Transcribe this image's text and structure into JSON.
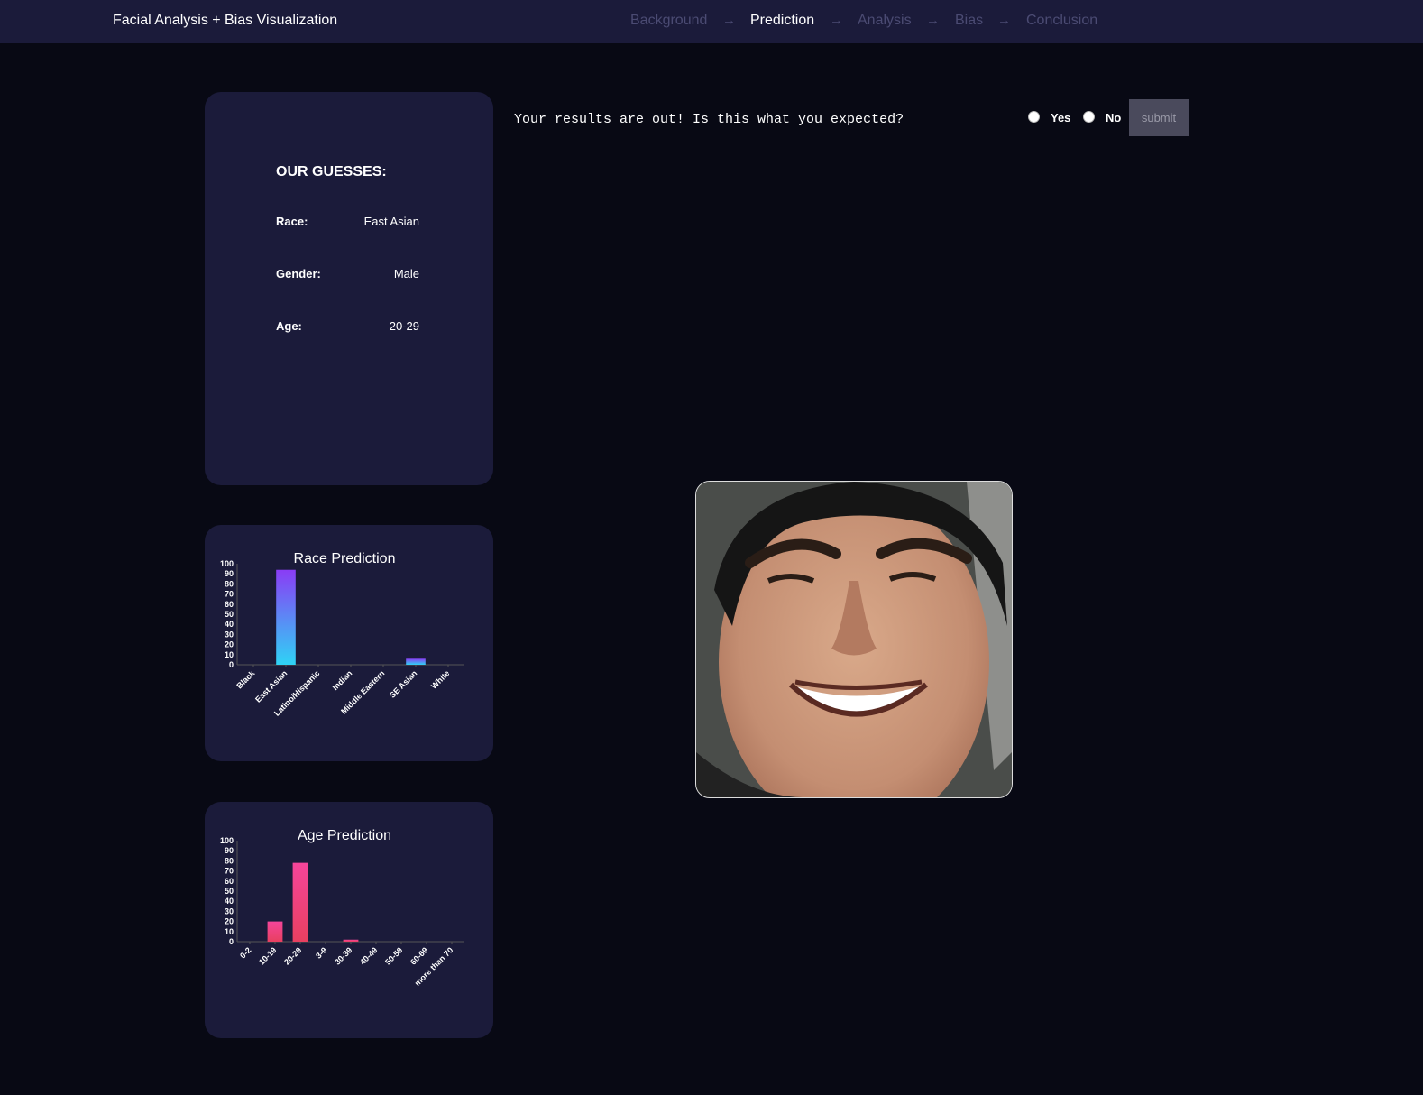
{
  "nav": {
    "title": "Facial Analysis + Bias Visualization",
    "steps": [
      "Background",
      "Prediction",
      "Analysis",
      "Bias",
      "Conclusion"
    ],
    "active_step": "Prediction",
    "arrow": "→"
  },
  "guesses": {
    "title": "OUR GUESSES:",
    "race_label": "Race:",
    "race_value": "East Asian",
    "gender_label": "Gender:",
    "gender_value": "Male",
    "age_label": "Age:",
    "age_value": "20-29"
  },
  "feedback": {
    "question": "Your results are out! Is this what you expected?",
    "yes_label": "Yes",
    "no_label": "No",
    "submit_label": "submit"
  },
  "photo": {
    "icon": "face-photo"
  },
  "colors": {
    "nav_bg": "#1b1b3a",
    "page_bg": "#080914",
    "race_bar_top": "#8a3cf5",
    "race_bar_bottom": "#2fd3f5",
    "age_bar_top": "#f5459a",
    "age_bar_bottom": "#e84060"
  },
  "chart_data": [
    {
      "type": "bar",
      "title": "Race Prediction",
      "categories": [
        "Black",
        "East Asian",
        "Latino/Hispanic",
        "Indian",
        "Middle Eastern",
        "SE Asian",
        "White"
      ],
      "values": [
        0,
        94,
        0,
        0,
        0,
        6,
        0
      ],
      "yticks": [
        0,
        10,
        20,
        30,
        40,
        50,
        60,
        70,
        80,
        90,
        100
      ],
      "ylim": [
        0,
        100
      ]
    },
    {
      "type": "bar",
      "title": "Age Prediction",
      "categories": [
        "0-2",
        "10-19",
        "20-29",
        "3-9",
        "30-39",
        "40-49",
        "50-59",
        "60-69",
        "more than 70"
      ],
      "values": [
        0,
        20,
        78,
        0,
        2,
        0,
        0,
        0,
        0
      ],
      "yticks": [
        0,
        10,
        20,
        30,
        40,
        50,
        60,
        70,
        80,
        90,
        100
      ],
      "ylim": [
        0,
        100
      ]
    }
  ]
}
